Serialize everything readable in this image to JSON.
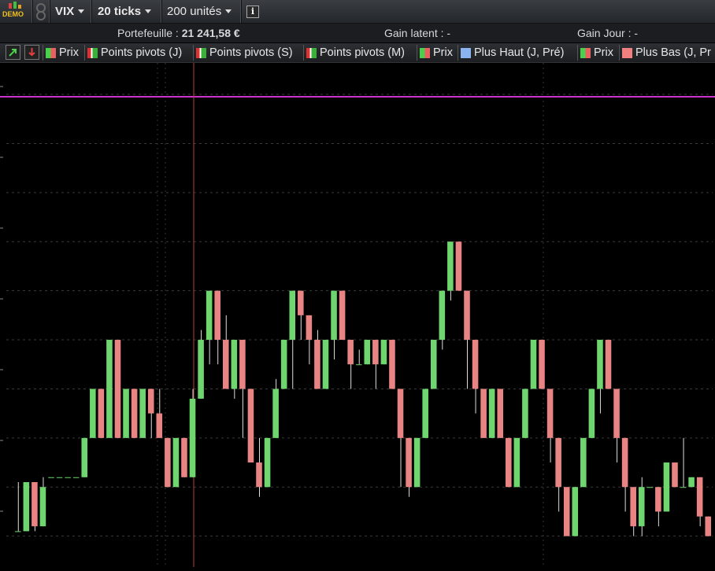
{
  "toolbar": {
    "demo_label": "DEMO",
    "symbol": "VIX",
    "ticks": "20 ticks",
    "units": "200 unités",
    "info_icon": "info-icon"
  },
  "info": {
    "portfolio_label": "Portefeuille :",
    "portfolio_value": "21 241,58 €",
    "latent_label": "Gain latent :",
    "latent_value": "-",
    "day_label": "Gain Jour :",
    "day_value": "-"
  },
  "legend": {
    "items": [
      {
        "label": "Prix"
      },
      {
        "label": "Points pivots (J)"
      },
      {
        "label": "Points pivots (S)"
      },
      {
        "label": "Points pivots (M)"
      },
      {
        "label": "Prix"
      },
      {
        "label": "Plus Haut (J, Pré)"
      },
      {
        "label": "Prix"
      },
      {
        "label": "Plus Bas (J, Pr"
      }
    ]
  },
  "colors": {
    "up": "#6fd66f",
    "down": "#e88484",
    "pivot_line": "#cc33cc",
    "cursor": "#b04040",
    "grid": "#3a3a3a"
  },
  "chart_data": {
    "type": "candlestick",
    "note_levels": [
      0,
      1,
      2,
      3,
      4,
      5,
      6,
      7,
      8,
      9
    ],
    "pivot_level": 9.55,
    "candles": [
      [
        0.1,
        0.1,
        0.1,
        1.1
      ],
      [
        0.1,
        1.1,
        0.1,
        1.1
      ],
      [
        1.1,
        0.2,
        0.1,
        1.1
      ],
      [
        0.2,
        1.0,
        0.2,
        1.2
      ],
      [
        1.2,
        1.2,
        1.2,
        1.2
      ],
      [
        1.2,
        1.2,
        1.2,
        1.2
      ],
      [
        1.2,
        1.2,
        1.2,
        1.2
      ],
      [
        1.2,
        1.2,
        1.2,
        1.2
      ],
      [
        1.2,
        2.0,
        1.2,
        2.0
      ],
      [
        2.0,
        3.0,
        2.0,
        3.0
      ],
      [
        3.0,
        2.0,
        2.0,
        3.0
      ],
      [
        2.0,
        4.0,
        2.0,
        4.0
      ],
      [
        4.0,
        2.0,
        2.0,
        4.0
      ],
      [
        2.0,
        3.0,
        2.0,
        3.0
      ],
      [
        3.0,
        2.0,
        2.0,
        3.0
      ],
      [
        2.0,
        3.0,
        2.0,
        3.0
      ],
      [
        3.0,
        2.5,
        2.0,
        3.0
      ],
      [
        2.5,
        2.0,
        2.0,
        3.0
      ],
      [
        2.0,
        1.0,
        1.0,
        2.0
      ],
      [
        1.0,
        2.0,
        1.0,
        2.0
      ],
      [
        2.0,
        1.2,
        1.2,
        2.0
      ],
      [
        1.2,
        2.8,
        1.2,
        3.0
      ],
      [
        2.8,
        4.0,
        2.8,
        4.2
      ],
      [
        4.0,
        5.0,
        3.5,
        5.0
      ],
      [
        5.0,
        4.0,
        3.5,
        5.0
      ],
      [
        4.0,
        3.0,
        3.0,
        4.5
      ],
      [
        3.0,
        4.0,
        2.8,
        4.0
      ],
      [
        4.0,
        3.0,
        2.0,
        4.0
      ],
      [
        3.0,
        1.5,
        1.5,
        3.0
      ],
      [
        1.5,
        1.0,
        0.8,
        2.0
      ],
      [
        1.0,
        2.0,
        1.0,
        2.0
      ],
      [
        2.0,
        3.0,
        2.0,
        3.2
      ],
      [
        3.0,
        4.0,
        3.0,
        4.0
      ],
      [
        4.0,
        5.0,
        3.0,
        5.0
      ],
      [
        5.0,
        4.5,
        4.0,
        5.0
      ],
      [
        4.5,
        4.0,
        3.5,
        4.5
      ],
      [
        4.0,
        3.0,
        3.0,
        4.2
      ],
      [
        3.0,
        4.0,
        3.0,
        4.0
      ],
      [
        4.0,
        5.0,
        3.6,
        5.0
      ],
      [
        5.0,
        4.0,
        4.0,
        5.0
      ],
      [
        4.0,
        3.5,
        3.0,
        4.0
      ],
      [
        3.5,
        3.5,
        3.5,
        3.8
      ],
      [
        3.5,
        4.0,
        3.5,
        4.0
      ],
      [
        4.0,
        3.5,
        3.0,
        4.0
      ],
      [
        3.5,
        4.0,
        3.5,
        4.0
      ],
      [
        4.0,
        3.0,
        3.0,
        4.0
      ],
      [
        3.0,
        2.0,
        1.0,
        3.0
      ],
      [
        2.0,
        1.0,
        0.8,
        2.0
      ],
      [
        1.0,
        2.0,
        1.0,
        2.0
      ],
      [
        2.0,
        3.0,
        2.0,
        3.0
      ],
      [
        3.0,
        4.0,
        3.0,
        4.0
      ],
      [
        4.0,
        5.0,
        3.8,
        5.0
      ],
      [
        5.0,
        6.0,
        4.8,
        6.0
      ],
      [
        6.0,
        5.0,
        5.0,
        6.0
      ],
      [
        5.0,
        4.0,
        3.0,
        5.0
      ],
      [
        4.0,
        3.0,
        2.5,
        4.0
      ],
      [
        3.0,
        2.0,
        2.0,
        3.0
      ],
      [
        2.0,
        3.0,
        2.0,
        3.0
      ],
      [
        3.0,
        2.0,
        2.0,
        3.0
      ],
      [
        2.0,
        1.0,
        1.0,
        2.0
      ],
      [
        1.0,
        2.0,
        1.0,
        2.0
      ],
      [
        2.0,
        3.0,
        2.0,
        3.0
      ],
      [
        3.0,
        4.0,
        3.0,
        4.0
      ],
      [
        4.0,
        3.0,
        3.0,
        4.0
      ],
      [
        3.0,
        2.0,
        1.5,
        3.0
      ],
      [
        2.0,
        1.0,
        0.5,
        2.0
      ],
      [
        1.0,
        0.0,
        0.0,
        1.0
      ],
      [
        0.0,
        1.0,
        0.0,
        1.0
      ],
      [
        1.0,
        2.0,
        1.0,
        2.0
      ],
      [
        2.0,
        3.0,
        2.0,
        3.0
      ],
      [
        3.0,
        4.0,
        2.5,
        4.0
      ],
      [
        4.0,
        3.0,
        3.0,
        4.0
      ],
      [
        3.0,
        2.0,
        1.5,
        3.0
      ],
      [
        2.0,
        1.0,
        0.5,
        2.0
      ],
      [
        1.0,
        0.2,
        0.0,
        1.0
      ],
      [
        0.2,
        1.0,
        0.0,
        1.2
      ],
      [
        1.0,
        1.0,
        1.0,
        1.0
      ],
      [
        1.0,
        0.5,
        0.2,
        1.0
      ],
      [
        0.5,
        1.5,
        0.5,
        1.5
      ],
      [
        1.5,
        1.0,
        1.0,
        1.5
      ],
      [
        1.0,
        1.0,
        1.0,
        2.0
      ],
      [
        1.0,
        1.2,
        1.0,
        1.2
      ],
      [
        1.2,
        0.4,
        0.2,
        1.2
      ],
      [
        0.4,
        0.0,
        0.0,
        0.4
      ]
    ]
  }
}
